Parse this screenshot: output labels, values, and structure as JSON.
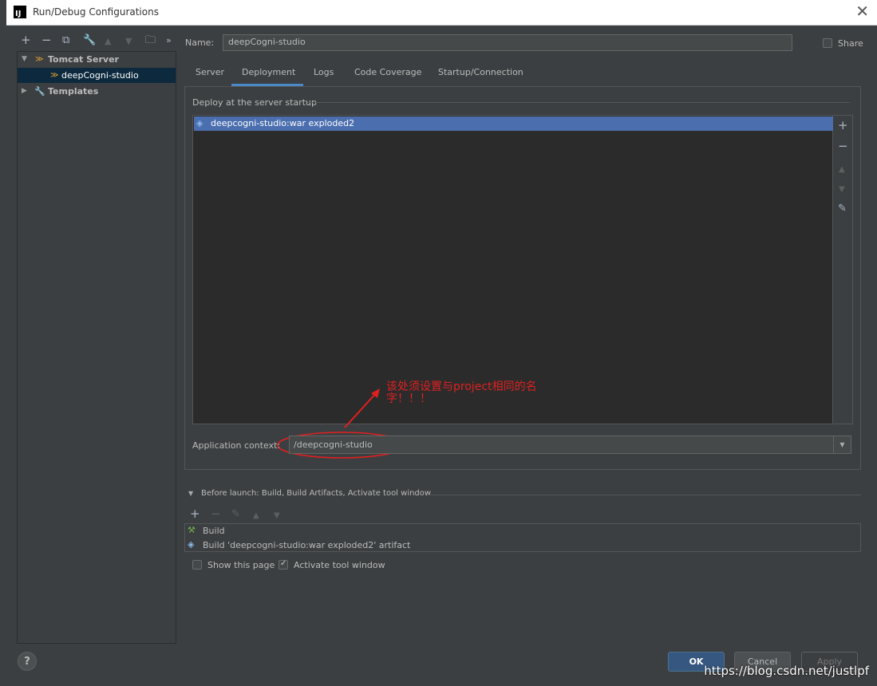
{
  "window": {
    "title": "Run/Debug Configurations",
    "app_icon": "IJ"
  },
  "tree": {
    "groups": [
      {
        "label": "Tomcat Server",
        "children": [
          "deepCogni-studio"
        ]
      },
      {
        "label": "Templates"
      }
    ]
  },
  "name_field": {
    "label": "Name:",
    "value": "deepCogni-studio"
  },
  "share_label": "Share",
  "tabs": [
    "Server",
    "Deployment",
    "Logs",
    "Code Coverage",
    "Startup/Connection"
  ],
  "active_tab": "Deployment",
  "deploy": {
    "section_title": "Deploy at the server startup",
    "items": [
      "deepcogni-studio:war exploded2"
    ]
  },
  "app_context": {
    "label": "Application context:",
    "value": "/deepcogni-studio"
  },
  "annotation": {
    "text": "该处须设置与project相同的名字！！！",
    "color": "#e02020"
  },
  "before_launch": {
    "title": "Before launch: Build, Build Artifacts, Activate tool window",
    "items": [
      "Build",
      "Build 'deepcogni-studio:war exploded2' artifact"
    ]
  },
  "options": {
    "show_this_page": "Show this page",
    "activate_tool_window": "Activate tool window"
  },
  "buttons": {
    "ok": "OK",
    "cancel": "Cancel",
    "apply": "Apply",
    "help": "?"
  },
  "watermark": "https://blog.csdn.net/justlpf",
  "colors": {
    "accent": "#4a88c7",
    "selection": "#4b6eaf",
    "tree_selection": "#0d293e",
    "ok_button": "#365880"
  }
}
